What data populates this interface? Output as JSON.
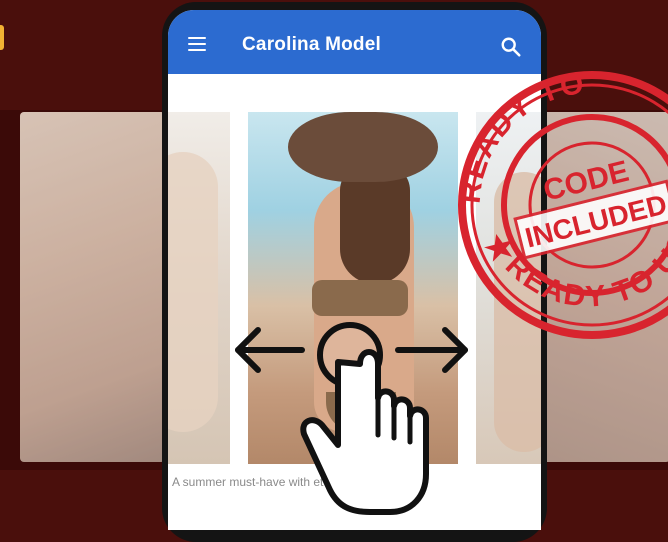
{
  "app": {
    "title": "Carolina Model",
    "caption": "A summer must-have with              et trendy decoration.",
    "theme_color": "#2c6bd0"
  },
  "icons": {
    "menu": "hamburger-menu-icon",
    "search": "search-icon",
    "gesture": "swipe-hand-icon"
  },
  "stamp": {
    "outer_top": "READY TO",
    "outer_bottom": "READY TO USE",
    "inner_top": "CODE",
    "inner_bottom": "INCLUDED",
    "color": "#d8242e"
  }
}
